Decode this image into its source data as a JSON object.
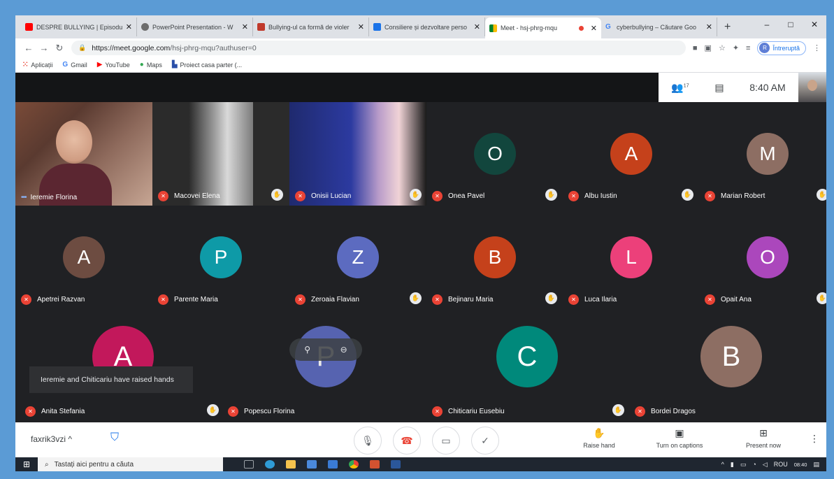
{
  "browser": {
    "tabs": [
      {
        "label": "DESPRE BULLYING | Episodu",
        "favicon_color": "#ff0000"
      },
      {
        "label": "PowerPoint Presentation - W",
        "favicon_color": "#6d6d6d"
      },
      {
        "label": "Bullying-ul ca formă de violer",
        "favicon_color": "#c0392b"
      },
      {
        "label": "Consiliere și dezvoltare perso",
        "favicon_color": "#1a73e8"
      },
      {
        "label": "Meet - hsj-phrg-mqu",
        "favicon_color": "#00832d",
        "active": true
      },
      {
        "label": "cyberbullying – Căutare Goo",
        "favicon_color": "#4285f4"
      }
    ],
    "close_glyph": "✕",
    "newtab_glyph": "+",
    "url_host": "https://meet.google.com",
    "url_path": "/hsj-phrg-mqu?authuser=0",
    "profile_label": "Întreruptă",
    "profile_initial": "R",
    "bookmarks": [
      {
        "label": "Aplicații",
        "icon": "apps-grid-icon",
        "color": "#ea4335"
      },
      {
        "label": "Gmail",
        "icon": "google-g-icon",
        "color": "#4285f4"
      },
      {
        "label": "YouTube",
        "icon": "youtube-icon",
        "color": "#ff0000"
      },
      {
        "label": "Maps",
        "icon": "maps-pin-icon",
        "color": "#34a853"
      },
      {
        "label": "Proiect casa parter (...",
        "icon": "house-plan-icon",
        "color": "#2b4fa8"
      }
    ]
  },
  "meet": {
    "participant_count": "17",
    "clock": "8:40 AM",
    "participants": [
      {
        "name": "Ieremie Florina",
        "type": "video",
        "muted": false
      },
      {
        "name": "Macovei Elena",
        "type": "video",
        "muted": true
      },
      {
        "name": "Onisii Lucian",
        "type": "video",
        "muted": true
      },
      {
        "name": "Onea Pavel",
        "initial": "O",
        "color": "#12463d",
        "muted": true
      },
      {
        "name": "Albu Iustin",
        "initial": "A",
        "color": "#c5411b",
        "muted": true
      },
      {
        "name": "Marian Robert",
        "initial": "M",
        "color": "#8d6e63",
        "muted": true
      },
      {
        "name": "Apetrei Razvan",
        "initial": "A",
        "color": "#6d4c41",
        "muted": true
      },
      {
        "name": "Parente Maria",
        "initial": "P",
        "color": "#0e9aa7",
        "muted": true
      },
      {
        "name": "Zeroaia Flavian",
        "initial": "Z",
        "color": "#5c6bc0",
        "muted": true
      },
      {
        "name": "Bejinaru Maria",
        "initial": "B",
        "color": "#c5411b",
        "muted": true
      },
      {
        "name": "Luca Ilaria",
        "initial": "L",
        "color": "#ec407a",
        "muted": true
      },
      {
        "name": "Opait Ana",
        "initial": "O",
        "color": "#ab47bc",
        "muted": true
      },
      {
        "name": "Anita Stefania",
        "initial": "A",
        "color": "#c2185b",
        "muted": true
      },
      {
        "name": "Popescu Florina",
        "initial": "P",
        "color": "#5c6bc0",
        "muted": true
      },
      {
        "name": "Chiticariu Eusebiu",
        "initial": "C",
        "color": "#00897b",
        "muted": true
      },
      {
        "name": "Bordei Dragos",
        "initial": "B",
        "color": "#8d6e63",
        "muted": true
      }
    ],
    "toast": "Ieremie and Chiticariu have raised hands",
    "meeting_code": "faxrik3vzi",
    "meeting_code_chevron": "^",
    "actions": {
      "raise_hand": "Raise hand",
      "captions": "Turn on captions",
      "present": "Present now"
    }
  },
  "taskbar": {
    "search_placeholder": "Tastați aici pentru a căuta",
    "lang": "ROU",
    "time": "08:40",
    "apps": [
      {
        "icon": "task-view-icon",
        "color": "#9aa0a6"
      },
      {
        "icon": "edge-icon",
        "color": "#2f9bd6"
      },
      {
        "icon": "file-explorer-icon",
        "color": "#f4c24d"
      },
      {
        "icon": "store-icon",
        "color": "#4a89dc"
      },
      {
        "icon": "mail-icon",
        "color": "#3a7bd5"
      },
      {
        "icon": "chrome-icon",
        "color": "#ea4335"
      },
      {
        "icon": "powerpoint-icon",
        "color": "#d35230"
      },
      {
        "icon": "word-icon",
        "color": "#2b579a"
      }
    ]
  }
}
